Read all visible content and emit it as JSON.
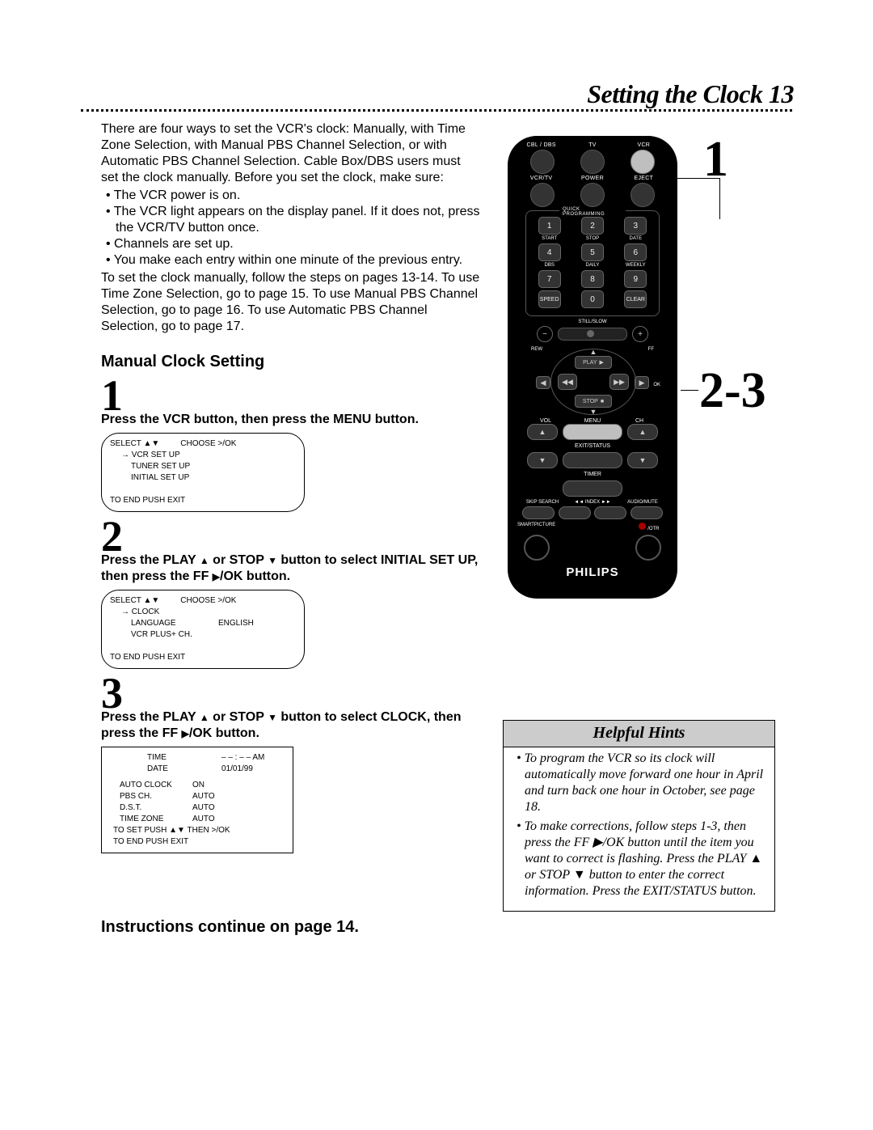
{
  "header": {
    "title": "Setting the Clock 13"
  },
  "intro": {
    "p1": "There are four ways to set the VCR's clock: Manually, with Time Zone Selection, with Manual PBS Channel Selection, or with Automatic PBS Channel Selection. Cable Box/DBS users must set the clock manually. Before you set the clock, make sure:",
    "bullets": [
      "The VCR power is on.",
      "The VCR light appears on the display panel. If it does not, press the VCR/TV button once.",
      "Channels are set up.",
      "You make each entry within one minute of the previous entry."
    ],
    "p2": "To set the clock manually, follow the steps on pages 13-14. To use Time Zone Selection, go to page 15. To use Manual PBS Channel Selection, go to page 16. To use Automatic PBS Channel Selection, go to page 17."
  },
  "section_title": "Manual Clock Setting",
  "steps": {
    "s1": {
      "num": "1",
      "text": "Press the VCR button, then press the MENU button."
    },
    "s2": {
      "num": "2",
      "text_a": "Press the PLAY ",
      "text_b": " or STOP ",
      "text_c": " button to select INITIAL SET UP, then press the FF ",
      "text_d": "/OK button."
    },
    "s3": {
      "num": "3",
      "text_a": "Press the PLAY ",
      "text_b": " or STOP ",
      "text_c": " button to select CLOCK, then press the FF ",
      "text_d": "/OK button."
    }
  },
  "osd1": {
    "head_l": "SELECT ▲▼",
    "head_r": "CHOOSE >/OK",
    "items": [
      "VCR SET UP",
      "TUNER SET UP",
      "INITIAL SET UP"
    ],
    "footer": "TO END PUSH EXIT"
  },
  "osd2": {
    "head_l": "SELECT ▲▼",
    "head_r": "CHOOSE >/OK",
    "rows": [
      {
        "k": "CLOCK",
        "v": ""
      },
      {
        "k": "LANGUAGE",
        "v": "ENGLISH"
      },
      {
        "k": "VCR PLUS+ CH.",
        "v": ""
      }
    ],
    "footer": "TO END PUSH EXIT"
  },
  "osd3": {
    "rows_top": [
      {
        "k": "TIME",
        "v": "– – : – –  AM"
      },
      {
        "k": "DATE",
        "v": "01/01/99"
      }
    ],
    "rows": [
      {
        "k": "AUTO CLOCK",
        "v": "ON"
      },
      {
        "k": "PBS CH.",
        "v": "AUTO"
      },
      {
        "k": "D.S.T.",
        "v": "AUTO"
      },
      {
        "k": "TIME ZONE",
        "v": "AUTO"
      }
    ],
    "f1": "TO SET PUSH ▲▼ THEN >/OK",
    "f2": "TO END PUSH EXIT"
  },
  "continue_text": "Instructions continue on page 14.",
  "callouts": {
    "one": "1",
    "two_three": "2-3"
  },
  "remote": {
    "top_labels": [
      "CBL / DBS",
      "TV",
      "VCR"
    ],
    "row2_labels": [
      "VCR/TV",
      "POWER",
      "EJECT"
    ],
    "keypad_title": "QUICK PROGRAMMING",
    "keypad_sub1": [
      "START",
      "STOP",
      "DATE"
    ],
    "keypad_sub2": [
      "DBS",
      "DAILY",
      "WEEKLY"
    ],
    "keypad": [
      [
        "1",
        "2",
        "3"
      ],
      [
        "4",
        "5",
        "6"
      ],
      [
        "7",
        "8",
        "9"
      ],
      [
        "SPEED",
        "0",
        "CLEAR"
      ]
    ],
    "stillslow": "STILL/SLOW",
    "rew": "REW",
    "ff": "FF",
    "ok": "OK",
    "play": "PLAY",
    "stop": "STOP",
    "vol_menu": [
      "VOL",
      "MENU",
      "CH"
    ],
    "exit": "EXIT/STATUS",
    "timer": "TIMER",
    "skip_labels": [
      "SKIP SEARCH",
      "◄◄ INDEX ►►",
      "AUDIO/MUTE"
    ],
    "bottom_l": "SMARTPICTURE",
    "bottom_r": "/OTR",
    "brand": "PHILIPS"
  },
  "hints": {
    "title": "Helpful Hints",
    "items": [
      "To program the VCR so its clock will automatically move forward one hour in April and turn back one hour in October, see page 18.",
      "To make corrections, follow steps 1-3, then press the FF ▶/OK button until the item you want to correct is flashing. Press the PLAY ▲ or STOP ▼ button to enter the correct information. Press the EXIT/STATUS button."
    ]
  }
}
